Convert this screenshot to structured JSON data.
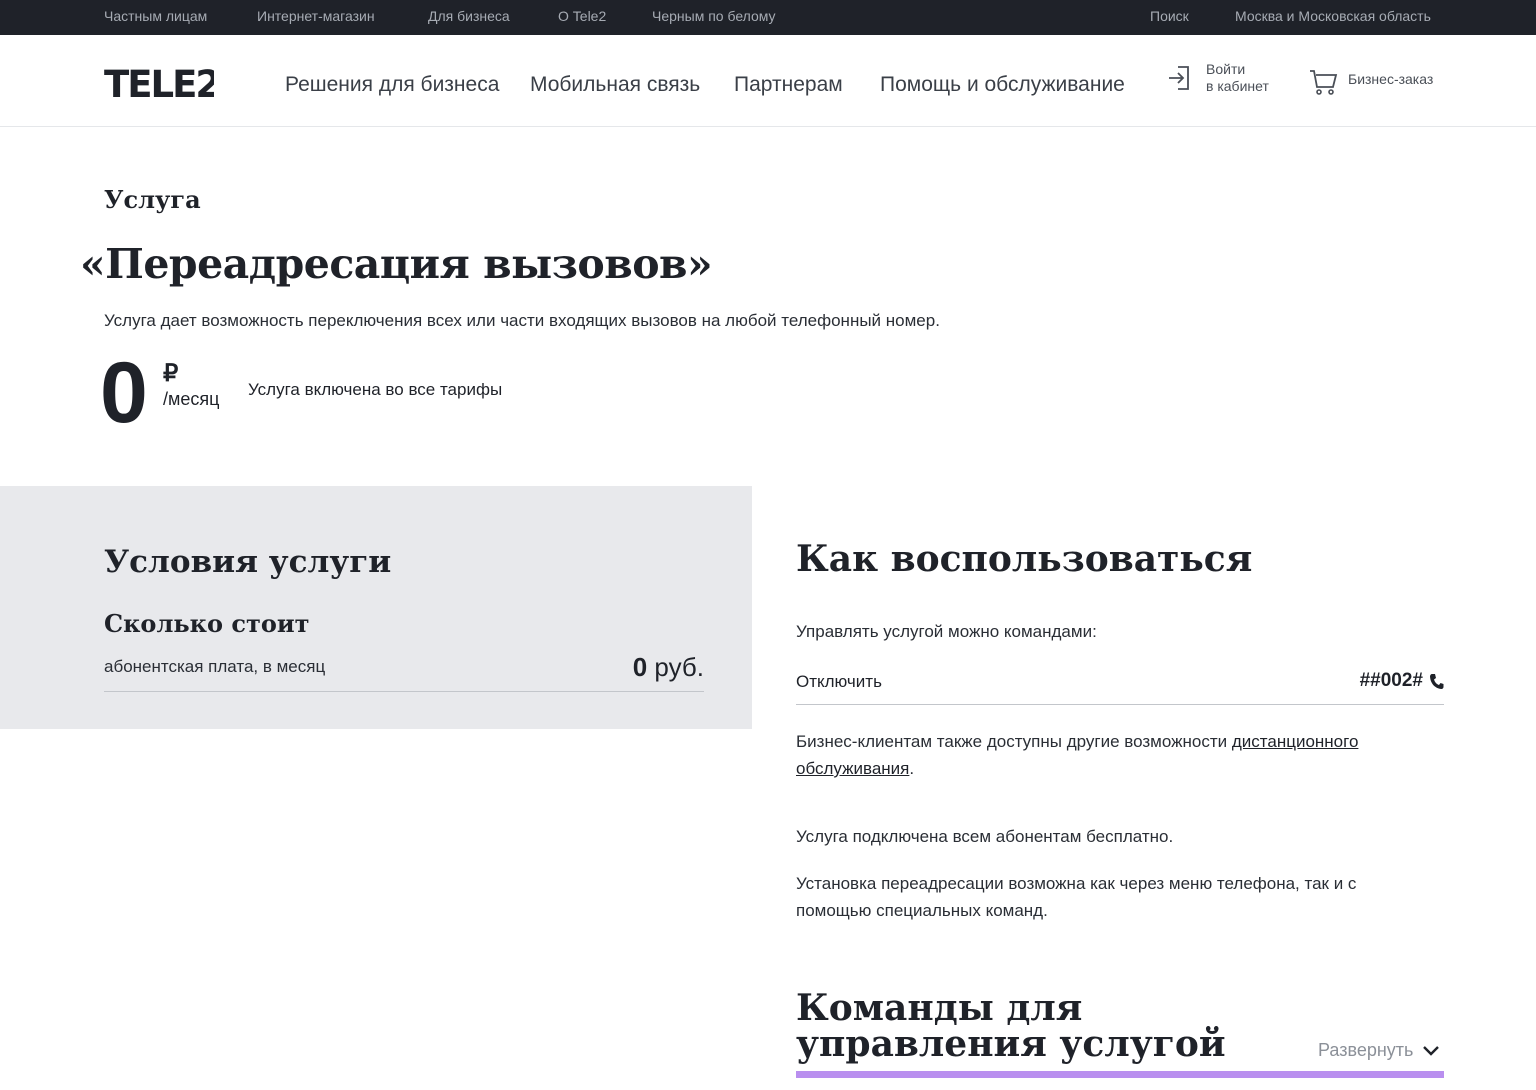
{
  "topbar": {
    "links": [
      "Частным лицам",
      "Интернет-магазин",
      "Для бизнеса",
      "О Tele2",
      "Черным по белому"
    ],
    "search": "Поиск",
    "region": "Москва и Московская область"
  },
  "header": {
    "logo_text": "TELE2",
    "nav": [
      "Решения для бизнеса",
      "Мобильная связь",
      "Партнерам",
      "Помощь и обслуживание"
    ],
    "login_line1": "Войти",
    "login_line2": "в кабинет",
    "cart_label": "Бизнес-заказ"
  },
  "service": {
    "kicker": "Услуга",
    "title": "«Переадресация вызовов»",
    "description": "Услуга дает возможность переключения всех или части входящих вызовов на любой телефонный номер.",
    "price_value": "0",
    "price_currency": "₽",
    "price_period": "/месяц",
    "price_note": "Услуга включена во все тарифы"
  },
  "conditions": {
    "heading": "Условия услуги",
    "subheading": "Сколько стоит",
    "fee_label": "абонентская плата, в месяц",
    "fee_amount": "0",
    "fee_unit": "руб."
  },
  "howto": {
    "heading": "Как воспользоваться",
    "commands_intro": "Управлять услугой можно командами:",
    "command_label": "Отключить",
    "command_code": "##002#",
    "remote_text_before": "Бизнес-клиентам также доступны другие возможности ",
    "remote_link_line1": "дистанционного",
    "remote_link_line2": "обслуживания",
    "remote_text_after": ".",
    "free_note": "Услуга подключена всем абонентам бесплатно.",
    "setup_line1": "Установка переадресации возможна как через меню телефона, так и с",
    "setup_line2": "помощью специальных команд.",
    "accordion_title": "Команды для управления услугой",
    "accordion_toggle": "Развернуть"
  },
  "colors": {
    "topbar_bg": "#1f2229",
    "panel_bg": "#e8e9ec",
    "accent": "#b98fef"
  }
}
